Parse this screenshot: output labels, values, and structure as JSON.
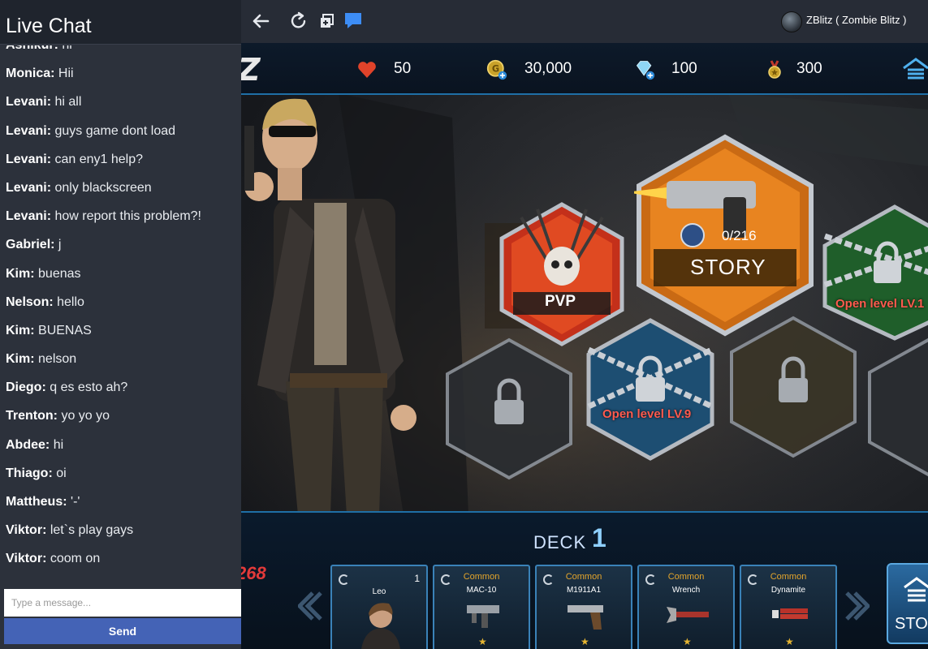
{
  "chat": {
    "title": "Live Chat",
    "messages": [
      {
        "user": "Ashikur",
        "text": "hi"
      },
      {
        "user": "Monica",
        "text": "Hii"
      },
      {
        "user": "Levani",
        "text": "hi all"
      },
      {
        "user": "Levani",
        "text": "guys game dont load"
      },
      {
        "user": "Levani",
        "text": "can eny1 help?"
      },
      {
        "user": "Levani",
        "text": "only blackscreen"
      },
      {
        "user": "Levani",
        "text": "how report this problem?!"
      },
      {
        "user": "Gabriel",
        "text": "j"
      },
      {
        "user": "Kim",
        "text": "buenas"
      },
      {
        "user": "Nelson",
        "text": "hello"
      },
      {
        "user": "Kim",
        "text": "BUENAS"
      },
      {
        "user": "Kim",
        "text": "nelson"
      },
      {
        "user": "Diego",
        "text": "q es esto ah?"
      },
      {
        "user": "Trenton",
        "text": "yo yo yo"
      },
      {
        "user": "Abdee",
        "text": "hi"
      },
      {
        "user": "Thiago",
        "text": "oi"
      },
      {
        "user": "Mattheus",
        "text": "'-'"
      },
      {
        "user": "Viktor",
        "text": "let`s play gays"
      },
      {
        "user": "Viktor",
        "text": "coom on"
      }
    ],
    "input_placeholder": "Type a message...",
    "input_value": "",
    "send_label": "Send"
  },
  "toolbar": {
    "icons": [
      "back-arrow-icon",
      "refresh-icon",
      "add-window-icon",
      "chat-bubble-icon"
    ],
    "game_title": "ZBlitz ( Zombie Blitz )"
  },
  "game": {
    "logo": "Z",
    "resources": {
      "hearts": "50",
      "gold": "30,000",
      "diamonds": "100",
      "medals": "300"
    },
    "modes": {
      "pvp_label": "PVP",
      "story_label": "STORY",
      "story_progress": "0/216",
      "locked_1_label": "Open level LV.1",
      "locked_9_label": "Open level LV.9"
    },
    "deck": {
      "label": "DECK",
      "number": "1",
      "score_fragment": "268",
      "cards": [
        {
          "rarity": "",
          "name": "Leo",
          "level": "1"
        },
        {
          "rarity": "Common",
          "name": "MAC-10",
          "level": ""
        },
        {
          "rarity": "Common",
          "name": "M1911A1",
          "level": ""
        },
        {
          "rarity": "Common",
          "name": "Wrench",
          "level": ""
        },
        {
          "rarity": "Common",
          "name": "Dynamite",
          "level": ""
        }
      ],
      "store_label": "STO"
    }
  },
  "colors": {
    "chat_bg": "#2c313b",
    "send_button": "#4463b6",
    "accent_blue": "#1f6fa6",
    "locked_text": "#ff5a4e"
  }
}
